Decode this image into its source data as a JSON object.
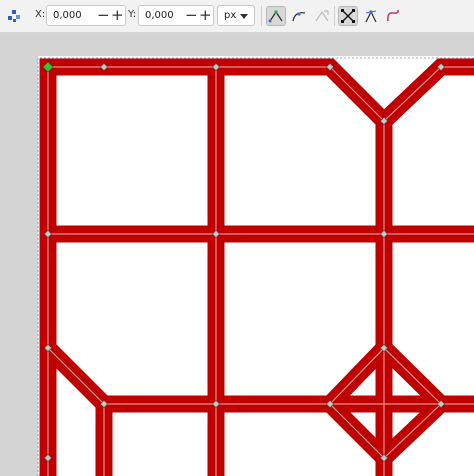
{
  "toolbar": {
    "x_label": "X:",
    "x_value": "0,000",
    "y_label": "Y:",
    "y_value": "0,000",
    "minus_glyph": "−",
    "plus_glyph": "+",
    "unit": "px",
    "tools": [
      {
        "name": "node-tool-icon"
      },
      {
        "name": "node-cusp-icon",
        "active": true
      },
      {
        "name": "node-smooth-icon"
      },
      {
        "name": "node-auto-icon",
        "disabled": true
      },
      {
        "name": "show-transform-handles-icon",
        "active": true
      },
      {
        "name": "show-handles-icon"
      },
      {
        "name": "show-path-outline-icon"
      }
    ]
  },
  "colors": {
    "stroke": "#c00000",
    "stroke_highlight": "#e8a9a9",
    "node_fill": "#c8c8c8",
    "selected_node": "#35c435",
    "canvas_bg": "#d4d4d4",
    "page_bg": "#ffffff"
  }
}
